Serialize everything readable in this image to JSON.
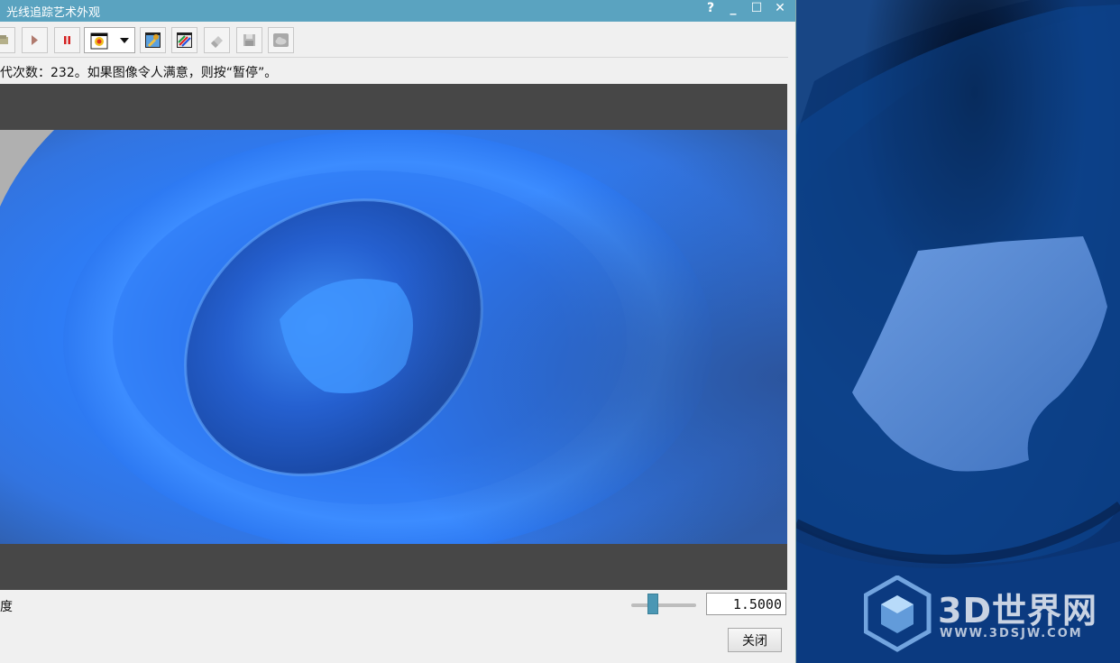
{
  "window": {
    "title": "光线追踪艺术外观",
    "help_glyph": "?",
    "minimize_glyph": "_",
    "maximize_glyph": "☐",
    "close_glyph": "✕"
  },
  "toolbar": {
    "buttons": [
      {
        "name": "refresh",
        "icon": "render-refresh-icon"
      },
      {
        "name": "play",
        "icon": "play-icon"
      },
      {
        "name": "pause",
        "icon": "pause-icon"
      },
      {
        "name": "light",
        "icon": "light-bulb-dropdown-icon"
      },
      {
        "name": "settings",
        "icon": "wrench-icon"
      },
      {
        "name": "colors",
        "icon": "color-pencils-icon"
      },
      {
        "name": "erase",
        "icon": "eraser-icon"
      },
      {
        "name": "save",
        "icon": "floppy-disk-icon"
      },
      {
        "name": "background",
        "icon": "cloud-icon"
      }
    ]
  },
  "status_text": "代次数：232。如果图像令人满意，则按“暂停”。",
  "brightness": {
    "label": "度",
    "value": "1.5000",
    "slider_fraction": 0.3
  },
  "close_button_label": "关闭",
  "watermark": {
    "text": "3D世界网",
    "url": "WWW.3DSJW.COM"
  },
  "colors": {
    "titlebar": "#5aa3c0",
    "accent_blue": "#2f80ff",
    "viewport_bg": "#474747"
  }
}
